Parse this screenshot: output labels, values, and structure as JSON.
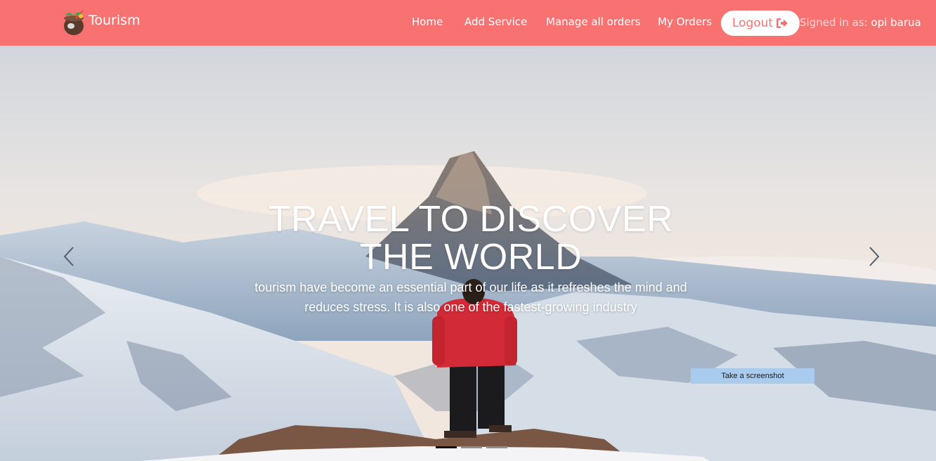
{
  "navbar": {
    "brand": {
      "label": "Tourism",
      "icon": "coconut-drink-icon"
    },
    "links": [
      {
        "label": "Home"
      },
      {
        "label": "Add Service"
      },
      {
        "label": "Manage all orders"
      },
      {
        "label": "My Orders"
      }
    ],
    "logout": {
      "label": "Logout",
      "icon": "sign-out-icon"
    },
    "signed_in": {
      "label": "Signed in as:",
      "user": "opi barua"
    }
  },
  "hero": {
    "title": "TRAVEL TO DISCOVER THE WORLD",
    "subtitle": "tourism have become an essential part of our life as it refreshes the mind and reduces stress. It is also one of the fastest-growing industry",
    "prev_icon": "chevron-left-icon",
    "next_icon": "chevron-right-icon",
    "slides_count": 3,
    "active_slide": 1
  },
  "overlay": {
    "screenshot_label": "Take a screenshot"
  },
  "colors": {
    "navbar": "#f87272",
    "logout_text": "#f87272",
    "white": "#ffffff"
  }
}
